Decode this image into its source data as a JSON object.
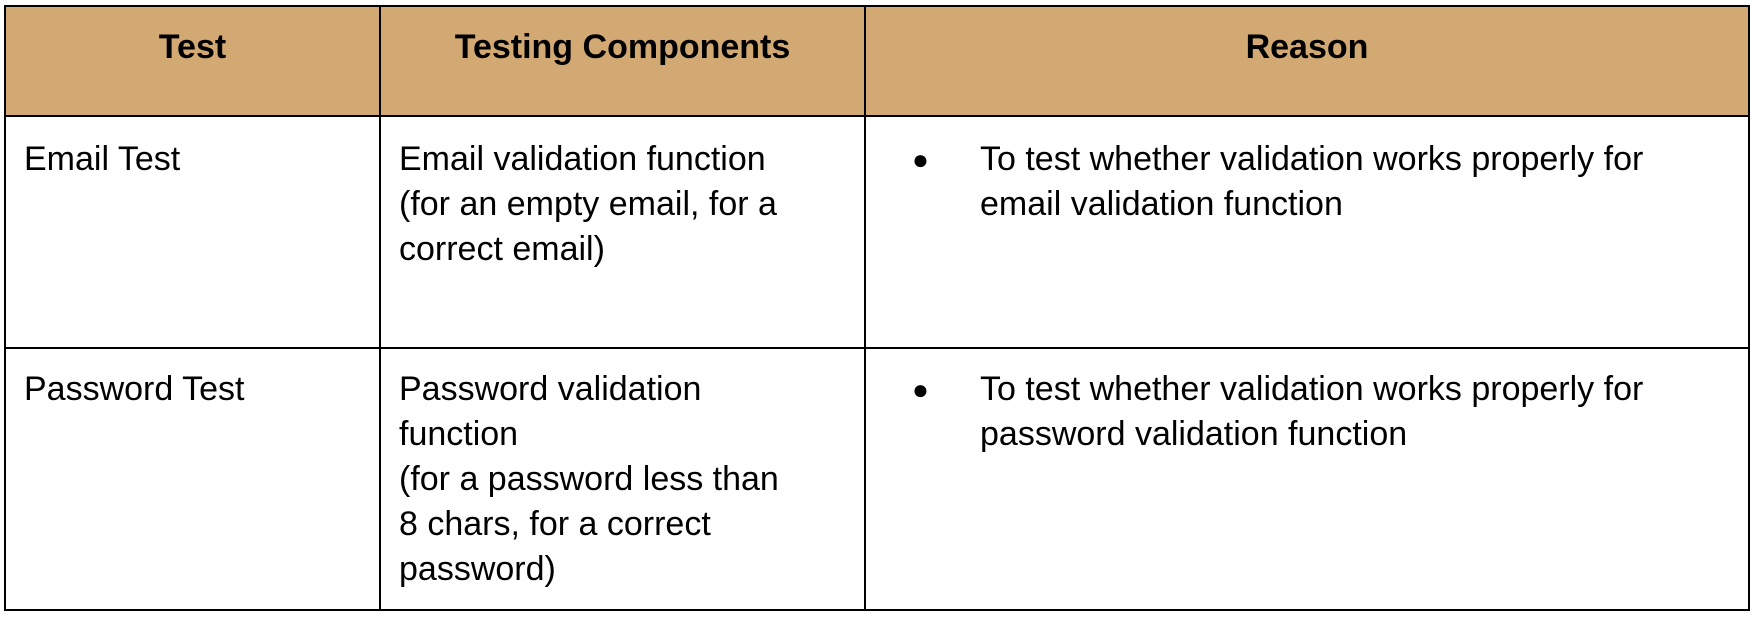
{
  "table": {
    "headers": [
      "Test",
      "Testing Components",
      "Reason"
    ],
    "rows": [
      {
        "test": "Email Test",
        "components": "Email validation function\n(for an empty email, for a\ncorrect email)",
        "reason": "To test whether validation works properly for email validation function"
      },
      {
        "test": "Password Test",
        "components": "Password validation\nfunction\n(for a password less than\n8 chars, for a correct\npassword)",
        "reason": "To test whether validation works properly for password validation function"
      }
    ],
    "bullet_glyph": "●",
    "header_color": "#d2a973"
  }
}
